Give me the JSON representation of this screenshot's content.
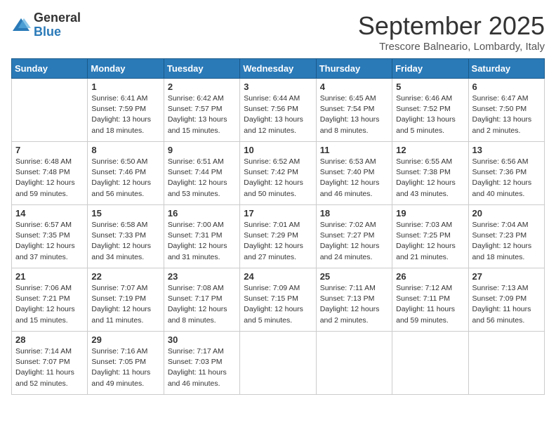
{
  "header": {
    "logo_general": "General",
    "logo_blue": "Blue",
    "month_title": "September 2025",
    "location": "Trescore Balneario, Lombardy, Italy"
  },
  "weekdays": [
    "Sunday",
    "Monday",
    "Tuesday",
    "Wednesday",
    "Thursday",
    "Friday",
    "Saturday"
  ],
  "weeks": [
    [
      {
        "day": "",
        "info": ""
      },
      {
        "day": "1",
        "info": "Sunrise: 6:41 AM\nSunset: 7:59 PM\nDaylight: 13 hours\nand 18 minutes."
      },
      {
        "day": "2",
        "info": "Sunrise: 6:42 AM\nSunset: 7:57 PM\nDaylight: 13 hours\nand 15 minutes."
      },
      {
        "day": "3",
        "info": "Sunrise: 6:44 AM\nSunset: 7:56 PM\nDaylight: 13 hours\nand 12 minutes."
      },
      {
        "day": "4",
        "info": "Sunrise: 6:45 AM\nSunset: 7:54 PM\nDaylight: 13 hours\nand 8 minutes."
      },
      {
        "day": "5",
        "info": "Sunrise: 6:46 AM\nSunset: 7:52 PM\nDaylight: 13 hours\nand 5 minutes."
      },
      {
        "day": "6",
        "info": "Sunrise: 6:47 AM\nSunset: 7:50 PM\nDaylight: 13 hours\nand 2 minutes."
      }
    ],
    [
      {
        "day": "7",
        "info": "Sunrise: 6:48 AM\nSunset: 7:48 PM\nDaylight: 12 hours\nand 59 minutes."
      },
      {
        "day": "8",
        "info": "Sunrise: 6:50 AM\nSunset: 7:46 PM\nDaylight: 12 hours\nand 56 minutes."
      },
      {
        "day": "9",
        "info": "Sunrise: 6:51 AM\nSunset: 7:44 PM\nDaylight: 12 hours\nand 53 minutes."
      },
      {
        "day": "10",
        "info": "Sunrise: 6:52 AM\nSunset: 7:42 PM\nDaylight: 12 hours\nand 50 minutes."
      },
      {
        "day": "11",
        "info": "Sunrise: 6:53 AM\nSunset: 7:40 PM\nDaylight: 12 hours\nand 46 minutes."
      },
      {
        "day": "12",
        "info": "Sunrise: 6:55 AM\nSunset: 7:38 PM\nDaylight: 12 hours\nand 43 minutes."
      },
      {
        "day": "13",
        "info": "Sunrise: 6:56 AM\nSunset: 7:36 PM\nDaylight: 12 hours\nand 40 minutes."
      }
    ],
    [
      {
        "day": "14",
        "info": "Sunrise: 6:57 AM\nSunset: 7:35 PM\nDaylight: 12 hours\nand 37 minutes."
      },
      {
        "day": "15",
        "info": "Sunrise: 6:58 AM\nSunset: 7:33 PM\nDaylight: 12 hours\nand 34 minutes."
      },
      {
        "day": "16",
        "info": "Sunrise: 7:00 AM\nSunset: 7:31 PM\nDaylight: 12 hours\nand 31 minutes."
      },
      {
        "day": "17",
        "info": "Sunrise: 7:01 AM\nSunset: 7:29 PM\nDaylight: 12 hours\nand 27 minutes."
      },
      {
        "day": "18",
        "info": "Sunrise: 7:02 AM\nSunset: 7:27 PM\nDaylight: 12 hours\nand 24 minutes."
      },
      {
        "day": "19",
        "info": "Sunrise: 7:03 AM\nSunset: 7:25 PM\nDaylight: 12 hours\nand 21 minutes."
      },
      {
        "day": "20",
        "info": "Sunrise: 7:04 AM\nSunset: 7:23 PM\nDaylight: 12 hours\nand 18 minutes."
      }
    ],
    [
      {
        "day": "21",
        "info": "Sunrise: 7:06 AM\nSunset: 7:21 PM\nDaylight: 12 hours\nand 15 minutes."
      },
      {
        "day": "22",
        "info": "Sunrise: 7:07 AM\nSunset: 7:19 PM\nDaylight: 12 hours\nand 11 minutes."
      },
      {
        "day": "23",
        "info": "Sunrise: 7:08 AM\nSunset: 7:17 PM\nDaylight: 12 hours\nand 8 minutes."
      },
      {
        "day": "24",
        "info": "Sunrise: 7:09 AM\nSunset: 7:15 PM\nDaylight: 12 hours\nand 5 minutes."
      },
      {
        "day": "25",
        "info": "Sunrise: 7:11 AM\nSunset: 7:13 PM\nDaylight: 12 hours\nand 2 minutes."
      },
      {
        "day": "26",
        "info": "Sunrise: 7:12 AM\nSunset: 7:11 PM\nDaylight: 11 hours\nand 59 minutes."
      },
      {
        "day": "27",
        "info": "Sunrise: 7:13 AM\nSunset: 7:09 PM\nDaylight: 11 hours\nand 56 minutes."
      }
    ],
    [
      {
        "day": "28",
        "info": "Sunrise: 7:14 AM\nSunset: 7:07 PM\nDaylight: 11 hours\nand 52 minutes."
      },
      {
        "day": "29",
        "info": "Sunrise: 7:16 AM\nSunset: 7:05 PM\nDaylight: 11 hours\nand 49 minutes."
      },
      {
        "day": "30",
        "info": "Sunrise: 7:17 AM\nSunset: 7:03 PM\nDaylight: 11 hours\nand 46 minutes."
      },
      {
        "day": "",
        "info": ""
      },
      {
        "day": "",
        "info": ""
      },
      {
        "day": "",
        "info": ""
      },
      {
        "day": "",
        "info": ""
      }
    ]
  ]
}
